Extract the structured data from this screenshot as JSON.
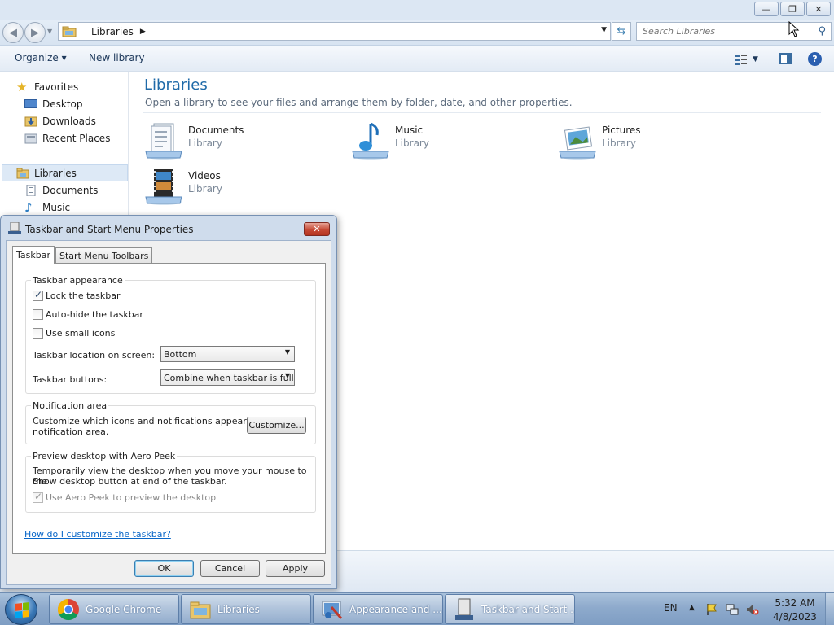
{
  "explorer": {
    "window_controls": {
      "minimize": "—",
      "restore": "❐",
      "close": "✕"
    },
    "address": {
      "path": "Libraries",
      "separator": "▶",
      "dropdown": "▼"
    },
    "search": {
      "placeholder": "Search Libraries"
    },
    "toolbar": {
      "organize": "Organize ▾",
      "new_library": "New library"
    },
    "nav": {
      "favorites": "Favorites",
      "desktop": "Desktop",
      "downloads": "Downloads",
      "recent_places": "Recent Places",
      "libraries": "Libraries",
      "documents": "Documents",
      "music": "Music"
    },
    "content": {
      "title": "Libraries",
      "subtitle": "Open a library to see your files and arrange them by folder, date, and other properties.",
      "items": [
        {
          "name": "Documents",
          "type": "Library"
        },
        {
          "name": "Music",
          "type": "Library"
        },
        {
          "name": "Pictures",
          "type": "Library"
        },
        {
          "name": "Videos",
          "type": "Library"
        }
      ]
    }
  },
  "dialog": {
    "title": "Taskbar and Start Menu Properties",
    "close": "✕",
    "tabs": [
      "Taskbar",
      "Start Menu",
      "Toolbars"
    ],
    "appearance": {
      "label": "Taskbar appearance",
      "lock": "Lock the taskbar",
      "autohide": "Auto-hide the taskbar",
      "small_icons": "Use small icons",
      "location_label": "Taskbar location on screen:",
      "location_value": "Bottom",
      "buttons_label": "Taskbar buttons:",
      "buttons_value": "Combine when taskbar is full"
    },
    "notification": {
      "label": "Notification area",
      "desc_line1": "Customize which icons and notifications appear in the",
      "desc_line2": "notification area.",
      "customize": "Customize..."
    },
    "peek": {
      "label": "Preview desktop with Aero Peek",
      "desc_line1": "Temporarily view the desktop when you move your mouse to the",
      "desc_line2": "Show desktop button at end of the taskbar.",
      "use_peek": "Use Aero Peek to preview the desktop"
    },
    "help_link": "How do I customize the taskbar?",
    "ok": "OK",
    "cancel": "Cancel",
    "apply": "Apply"
  },
  "taskbar": {
    "tasks": [
      "Google Chrome",
      "Libraries",
      "Appearance and ...",
      "Taskbar and Start ..."
    ],
    "language": "EN",
    "tray_arrow": "▲",
    "time": "5:32 AM",
    "date": "4/8/2023"
  },
  "colors": {
    "link": "#0a67c8",
    "title_blue": "#1f6aa8",
    "taskbar": "#8eaacc",
    "close_red": "#c64a36"
  }
}
